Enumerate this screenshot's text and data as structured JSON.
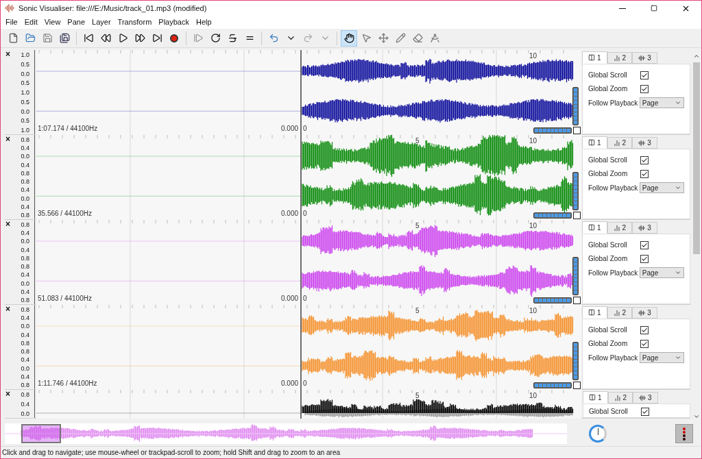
{
  "window": {
    "title": "Sonic Visualiser: file:///E:/Music/track_01.mp3 (modified)"
  },
  "menu": [
    "File",
    "Edit",
    "View",
    "Pane",
    "Layer",
    "Transform",
    "Playback",
    "Help"
  ],
  "mode_tools": [
    {
      "selected": true
    },
    {
      "selected": false
    },
    {
      "selected": false
    },
    {
      "selected": false
    },
    {
      "selected": false
    },
    {
      "selected": false
    }
  ],
  "panes": [
    {
      "close": "×",
      "color": "#0a0a9a",
      "kind": "full",
      "scale": [
        "1.0",
        "0.5",
        "0.0",
        "0.5",
        "1.0",
        "0.5",
        "0.0",
        "0.5",
        "1.0"
      ],
      "time_ticks": [
        "10"
      ],
      "info": "1:07.174 / 44100Hz",
      "start_time": "0.000",
      "start_frame": "0",
      "tabs": [
        {
          "label": "1",
          "selected": true
        },
        {
          "label": "2",
          "selected": false
        },
        {
          "label": "3",
          "selected": false
        }
      ],
      "global_scroll": {
        "label": "Global Scroll",
        "checked": true
      },
      "global_zoom": {
        "label": "Global Zoom",
        "checked": true
      },
      "follow_playback": {
        "label": "Follow Playback",
        "value": "Page"
      }
    },
    {
      "close": "×",
      "color": "#0a8a0a",
      "kind": "full",
      "scale": [
        "0.8",
        "0.4",
        "0.0",
        "0.4",
        "0.8",
        "0.8",
        "0.4",
        "0.0",
        "0.4",
        "0.8"
      ],
      "time_ticks": [
        "5",
        "10"
      ],
      "info": "35.566 / 44100Hz",
      "start_time": "0.000",
      "start_frame": "0",
      "tabs": [
        {
          "label": "1",
          "selected": true
        },
        {
          "label": "2",
          "selected": false
        },
        {
          "label": "3",
          "selected": false
        }
      ],
      "global_scroll": {
        "label": "Global Scroll",
        "checked": true
      },
      "global_zoom": {
        "label": "Global Zoom",
        "checked": true
      },
      "follow_playback": {
        "label": "Follow Playback",
        "value": "Page"
      }
    },
    {
      "close": "×",
      "color": "#cc44ee",
      "kind": "full",
      "scale": [
        "0.8",
        "0.4",
        "0.0",
        "0.4",
        "0.8",
        "0.8",
        "0.4",
        "0.0",
        "0.4",
        "0.8"
      ],
      "time_ticks": [
        "5",
        "10"
      ],
      "info": "51.083 / 44100Hz",
      "start_time": "0.000",
      "start_frame": "0",
      "tabs": [
        {
          "label": "1",
          "selected": true
        },
        {
          "label": "2",
          "selected": false
        },
        {
          "label": "3",
          "selected": false
        }
      ],
      "global_scroll": {
        "label": "Global Scroll",
        "checked": true
      },
      "global_zoom": {
        "label": "Global Zoom",
        "checked": true
      },
      "follow_playback": {
        "label": "Follow Playback",
        "value": "Page"
      }
    },
    {
      "close": "×",
      "color": "#f5922e",
      "kind": "full",
      "scale": [
        "0.8",
        "0.4",
        "0.0",
        "0.4",
        "0.8",
        "0.8",
        "0.4",
        "0.0",
        "0.4",
        "0.8"
      ],
      "time_ticks": [
        "5",
        "10"
      ],
      "info": "1:11.746 / 44100Hz",
      "start_time": "0.000",
      "start_frame": "0",
      "tabs": [
        {
          "label": "1",
          "selected": true
        },
        {
          "label": "2",
          "selected": false
        },
        {
          "label": "3",
          "selected": false
        }
      ],
      "global_scroll": {
        "label": "Global Scroll",
        "checked": true
      },
      "global_zoom": {
        "label": "Global Zoom",
        "checked": true
      },
      "follow_playback": {
        "label": "Follow Playback",
        "value": "Page"
      }
    },
    {
      "close": "×",
      "color": "#000000",
      "kind": "cut",
      "scale": [
        "0.8",
        "0.4",
        "0.0"
      ],
      "time_ticks": [
        "5",
        "10"
      ],
      "tabs": [
        {
          "label": "1",
          "selected": true
        },
        {
          "label": "2",
          "selected": false
        },
        {
          "label": "3",
          "selected": false
        }
      ],
      "global_scroll": {
        "label": "Global Scroll",
        "checked": true
      }
    }
  ],
  "status_bar": "Click and drag to navigate; use mouse-wheel or trackpad-scroll to zoom; hold Shift and drag to zoom to an area"
}
